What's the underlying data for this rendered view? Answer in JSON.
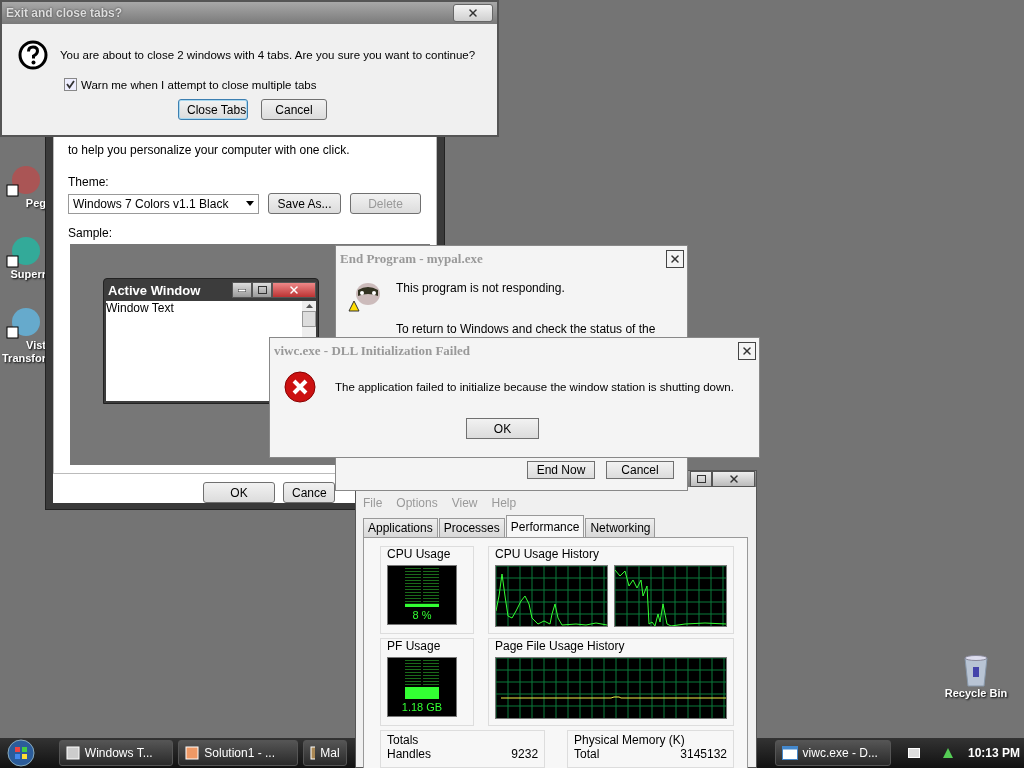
{
  "desktop_icons": [
    {
      "label": "Peg"
    },
    {
      "label": "Superr"
    },
    {
      "label": "Vist Transfor"
    },
    {
      "label": "Recycle Bin"
    }
  ],
  "theme_window": {
    "intro": "to help you personalize your computer with one click.",
    "theme_label": "Theme:",
    "theme_value": "Windows 7 Colors v1.1 Black",
    "buttons": [
      {
        "label": "Save As...",
        "disabled": false
      },
      {
        "label": "Delete",
        "disabled": true
      }
    ],
    "sample_label": "Sample:",
    "sample_title": "Active Window",
    "sample_text": "Window Text",
    "footer_buttons": [
      "OK",
      "Cance"
    ]
  },
  "exit_dialog": {
    "title": "Exit and close tabs?",
    "message": "You are about to close 2 windows with 4 tabs. Are you sure you want to continue?",
    "checkbox": {
      "label": "Warn me when I attempt to close multiple tabs",
      "checked": true
    },
    "buttons": [
      {
        "label": "Close Tabs",
        "selected": true
      },
      {
        "label": "Cancel",
        "selected": false
      }
    ]
  },
  "end_program": {
    "title": "End Program - mypal.exe",
    "lines": [
      "This program is not responding.",
      "To return to Windows and check the status of the"
    ],
    "buttons": [
      "End Now",
      "Cancel"
    ]
  },
  "dll_error": {
    "title": "viwc.exe - DLL Initialization Failed",
    "message": "The application failed to initialize because the window station is shutting down.",
    "button": "OK"
  },
  "task_manager": {
    "menu": [
      "File",
      "Options",
      "View",
      "Help"
    ],
    "tabs": [
      {
        "label": "Applications",
        "selected": false
      },
      {
        "label": "Processes",
        "selected": false
      },
      {
        "label": "Performance",
        "selected": true
      },
      {
        "label": "Networking",
        "selected": false
      }
    ],
    "cpu_usage": {
      "title": "CPU Usage",
      "reading": "8 %",
      "level": 0.08
    },
    "cpu_history": {
      "title": "CPU Usage History"
    },
    "pf_usage": {
      "title": "PF Usage",
      "reading": "1.18 GB",
      "level": 0.3
    },
    "pf_history": {
      "title": "Page File Usage History"
    },
    "totals": {
      "title": "Totals",
      "rows": [
        {
          "label": "Handles",
          "value": "9232"
        }
      ]
    },
    "physical_memory": {
      "title": "Physical Memory (K)",
      "rows": [
        {
          "label": "Total",
          "value": "3145132"
        }
      ]
    }
  },
  "taskbar": {
    "items": [
      {
        "label": "Windows T...",
        "selected": false
      },
      {
        "label": "Solution1 - ...",
        "selected": false
      },
      {
        "label": "Mal",
        "selected": false
      },
      {
        "label": "viwc.exe - D...",
        "selected": false
      }
    ],
    "clock": "10:13 PM"
  }
}
